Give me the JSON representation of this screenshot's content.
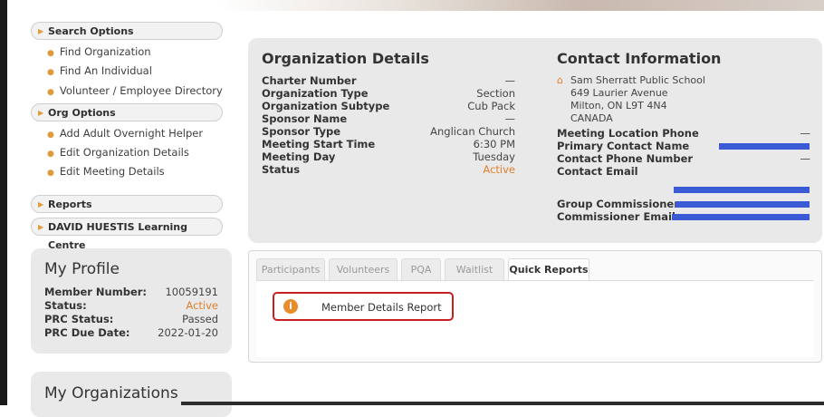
{
  "sidebar": {
    "search_options": "Search Options",
    "search_items": [
      "Find Organization",
      "Find An Individual",
      "Volunteer / Employee Directory"
    ],
    "org_options": "Org Options",
    "org_items": [
      "Add Adult Overnight Helper",
      "Edit Organization Details",
      "Edit Meeting Details"
    ],
    "reports": "Reports",
    "learning_centre": "DAVID HUESTIS Learning Centre"
  },
  "profile": {
    "title": "My Profile",
    "rows": [
      {
        "label": "Member Number:",
        "value": "10059191"
      },
      {
        "label": "Status:",
        "value": "Active"
      },
      {
        "label": "PRC Status:",
        "value": "Passed"
      },
      {
        "label": "PRC Due Date:",
        "value": "2022-01-20"
      }
    ]
  },
  "organizations": {
    "title": "My Organizations"
  },
  "org_details": {
    "title": "Organization Details",
    "rows": [
      {
        "label": "Charter Number",
        "value": "—"
      },
      {
        "label": "Organization Type",
        "value": "Section"
      },
      {
        "label": "Organization Subtype",
        "value": "Cub Pack"
      },
      {
        "label": "Sponsor Name",
        "value": "—"
      },
      {
        "label": "Sponsor Type",
        "value": "Anglican Church"
      },
      {
        "label": "Meeting Start Time",
        "value": "6:30 PM"
      },
      {
        "label": "Meeting Day",
        "value": "Tuesday"
      },
      {
        "label": "Status",
        "value": "Active"
      }
    ]
  },
  "contact": {
    "title": "Contact Information",
    "address": [
      "Sam Sherratt Public School",
      "649 Laurier Avenue",
      "Milton, ON L9T 4N4",
      "CANADA"
    ],
    "meeting_phone_label": "Meeting Location Phone",
    "meeting_phone_value": "—",
    "primary_contact_label": "Primary Contact Name",
    "contact_phone_label": "Contact Phone Number",
    "contact_phone_value": "—",
    "contact_email_label": "Contact Email",
    "group_commissioner_label": "Group Commissioner",
    "commissioner_email_label": "Commissioner Email"
  },
  "tabs": [
    "Participants",
    "Volunteers",
    "PQA",
    "Waitlist",
    "Quick Reports"
  ],
  "quick_reports": {
    "item": "Member Details Report"
  },
  "colors": {
    "accent": "#e07f2a",
    "highlight_border": "#c62020",
    "redaction": "#3a5ad6"
  }
}
